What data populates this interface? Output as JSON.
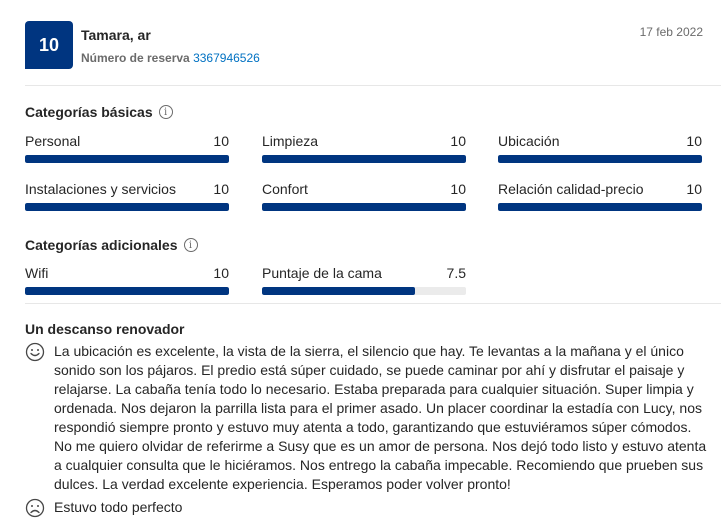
{
  "review": {
    "score": "10",
    "reviewer": "Tamara, ar",
    "reservation_label": "Número de reserva",
    "reservation_number": "3367946526",
    "date": "17 feb 2022"
  },
  "basic": {
    "title": "Categorías básicas",
    "info_glyph": "i",
    "items": [
      {
        "label": "Personal",
        "value": "10",
        "score": 10
      },
      {
        "label": "Limpieza",
        "value": "10",
        "score": 10
      },
      {
        "label": "Ubicación",
        "value": "10",
        "score": 10
      },
      {
        "label": "Instalaciones y servicios",
        "value": "10",
        "score": 10
      },
      {
        "label": "Confort",
        "value": "10",
        "score": 10
      },
      {
        "label": "Relación calidad-precio",
        "value": "10",
        "score": 10
      }
    ]
  },
  "additional": {
    "title": "Categorías adicionales",
    "info_glyph": "i",
    "items": [
      {
        "label": "Wifi",
        "value": "10",
        "score": 10
      },
      {
        "label": "Puntaje de la cama",
        "value": "7.5",
        "score": 7.5
      }
    ]
  },
  "body": {
    "title": "Un descanso renovador",
    "positive_icon": "smiling-face-icon",
    "positive": "La ubicación es excelente, la vista de la sierra, el silencio que hay. Te levantas a la mañana y el único sonido son los pájaros. El predio está súper cuidado, se puede caminar por ahí y disfrutar el paisaje y relajarse. La cabaña tenía todo lo necesario. Estaba preparada para cualquier situación. Super limpia y ordenada. Nos dejaron la parrilla lista para el primer asado. Un placer coordinar la estadía con Lucy, nos respondió siempre pronto y estuvo muy atenta a todo, garantizando que estuviéramos súper cómodos. No me quiero olvidar de referirme a Susy que es un amor de persona. Nos dejó todo listo y estuvo atenta a cualquier consulta que le hiciéramos. Nos entrego la cabaña impecable. Recomiendo que prueben sus dulces. La verdad excelente experiencia. Esperamos poder volver pronto!",
    "negative_icon": "frowning-face-icon",
    "negative": "Estuvo todo perfecto"
  },
  "colors": {
    "accent": "#003580",
    "link": "#0071c2",
    "bar_track": "#ebebeb"
  },
  "scale_max": 10
}
